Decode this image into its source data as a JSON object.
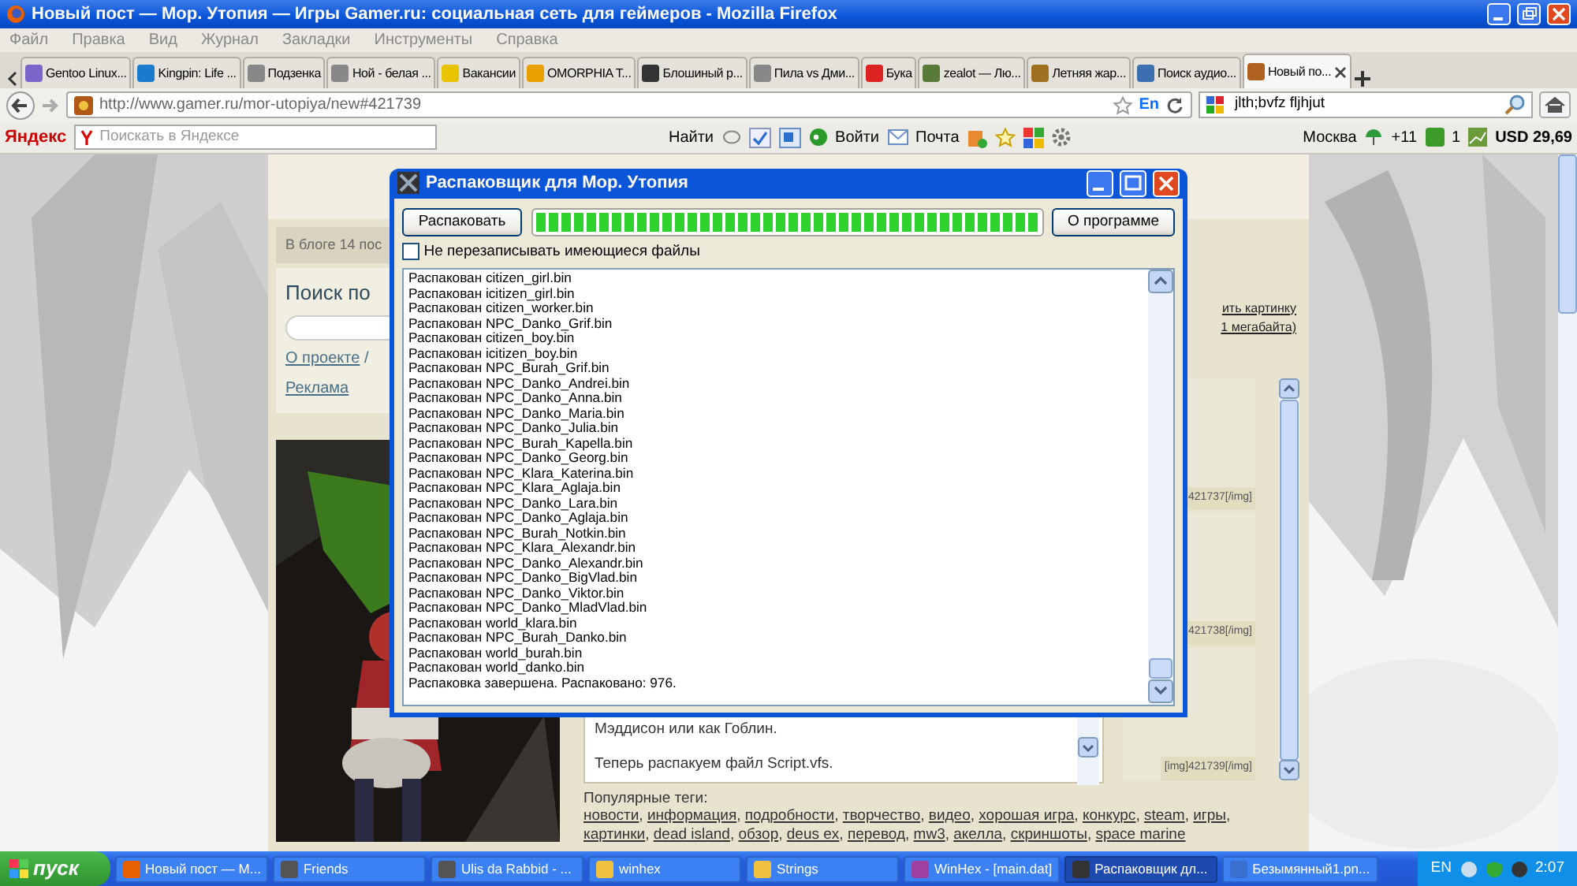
{
  "window": {
    "title": "Новый пост — Мор. Утопия — Игры Gamer.ru: социальная сеть для геймеров - Mozilla Firefox"
  },
  "menu": [
    "Файл",
    "Правка",
    "Вид",
    "Журнал",
    "Закладки",
    "Инструменты",
    "Справка"
  ],
  "tabs": [
    {
      "label": "Gentoo Linux...",
      "selected": false
    },
    {
      "label": "Kingpin: Life ...",
      "selected": false
    },
    {
      "label": "Подзенка",
      "selected": false
    },
    {
      "label": "Ной - белая ...",
      "selected": false
    },
    {
      "label": "Вакансии",
      "selected": false
    },
    {
      "label": "OMORPHIA T...",
      "selected": false
    },
    {
      "label": "Блошиный р...",
      "selected": false
    },
    {
      "label": "Пила vs Дми...",
      "selected": false
    },
    {
      "label": "Бука",
      "selected": false
    },
    {
      "label": "zealot — Лю...",
      "selected": false
    },
    {
      "label": "Летняя жар...",
      "selected": false
    },
    {
      "label": "Поиск аудио...",
      "selected": false
    },
    {
      "label": "Новый по...",
      "selected": true
    }
  ],
  "address": {
    "url": "http://www.gamer.ru/mor-utopiya/new#421739",
    "lang": "En"
  },
  "search": {
    "value": "jlth;bvfz fljhjut"
  },
  "yandex_bar": {
    "logo": "Яндекс",
    "placeholder": "Поискать в Яндексе",
    "find": "Найти",
    "login": "Войти",
    "mail": "Почта",
    "city": "Москва",
    "weather": "+11",
    "count": "1",
    "currency": "USD 29,69"
  },
  "page": {
    "blog_info": "В блоге 14 пос",
    "search_title": "Поиск по",
    "about_link": "О проекте",
    "link_separator": "/",
    "ads_link": "Реклама",
    "upload_link_1": "ить картинку",
    "upload_link_2": "1 мегабайта)",
    "editor_lines": [
      "Мэддисон или как Гоблин.",
      "Теперь распакуем файл Script.vfs."
    ],
    "image_codes": [
      "421737[/img]",
      "421738[/img]",
      "[img]421739[/img]"
    ],
    "tags_label": "Популярные теги:",
    "tag_separator": ",",
    "tags": [
      "новости",
      "информация",
      "подробности",
      "творчество",
      "видео",
      "хорошая игра",
      "конкурс",
      "steam",
      "игры",
      "картинки",
      "dead island",
      "обзор",
      "deus ex",
      "перевод",
      "mw3",
      "акелла",
      "скриншоты",
      "space marine"
    ]
  },
  "dialog": {
    "title": "Распаковщик для Мор. Утопия",
    "unpack_button": "Распаковать",
    "progress": {
      "level": 1
    },
    "about_button": "О программе",
    "overwrite": {
      "label": "Не перезаписывать имеющиеся файлы",
      "checked": false
    },
    "log": [
      "Распакован citizen_girl.bin",
      "Распакован icitizen_girl.bin",
      "Распакован citizen_worker.bin",
      "Распакован NPC_Danko_Grif.bin",
      "Распакован citizen_boy.bin",
      "Распакован icitizen_boy.bin",
      "Распакован NPC_Burah_Grif.bin",
      "Распакован NPC_Danko_Andrei.bin",
      "Распакован NPC_Danko_Anna.bin",
      "Распакован NPC_Danko_Maria.bin",
      "Распакован NPC_Danko_Julia.bin",
      "Распакован NPC_Burah_Kapella.bin",
      "Распакован NPC_Danko_Georg.bin",
      "Распакован NPC_Klara_Katerina.bin",
      "Распакован NPC_Klara_Aglaja.bin",
      "Распакован NPC_Danko_Lara.bin",
      "Распакован NPC_Danko_Aglaja.bin",
      "Распакован NPC_Burah_Notkin.bin",
      "Распакован NPC_Klara_Alexandr.bin",
      "Распакован NPC_Danko_Alexandr.bin",
      "Распакован NPC_Danko_BigVlad.bin",
      "Распакован NPC_Danko_Viktor.bin",
      "Распакован NPC_Danko_MladVlad.bin",
      "Распакован world_klara.bin",
      "Распакован NPC_Burah_Danko.bin",
      "Распакован world_burah.bin",
      "Распакован world_danko.bin",
      "Распаковка завершена. Распаковано: 976."
    ]
  },
  "taskbar": {
    "start": "пуск",
    "items": [
      {
        "label": "Новый пост — М...",
        "selected": false
      },
      {
        "label": "Friends",
        "selected": false
      },
      {
        "label": "Ulis da Rabbid - ...",
        "selected": false
      },
      {
        "label": "winhex",
        "selected": false
      },
      {
        "label": "Strings",
        "selected": false
      },
      {
        "label": "WinHex - [main.dat]",
        "selected": false
      },
      {
        "label": "Распаковщик дл...",
        "selected": true
      },
      {
        "label": "Безымянный1.pn...",
        "selected": false
      }
    ],
    "lang": "EN",
    "clock": "2:07"
  }
}
